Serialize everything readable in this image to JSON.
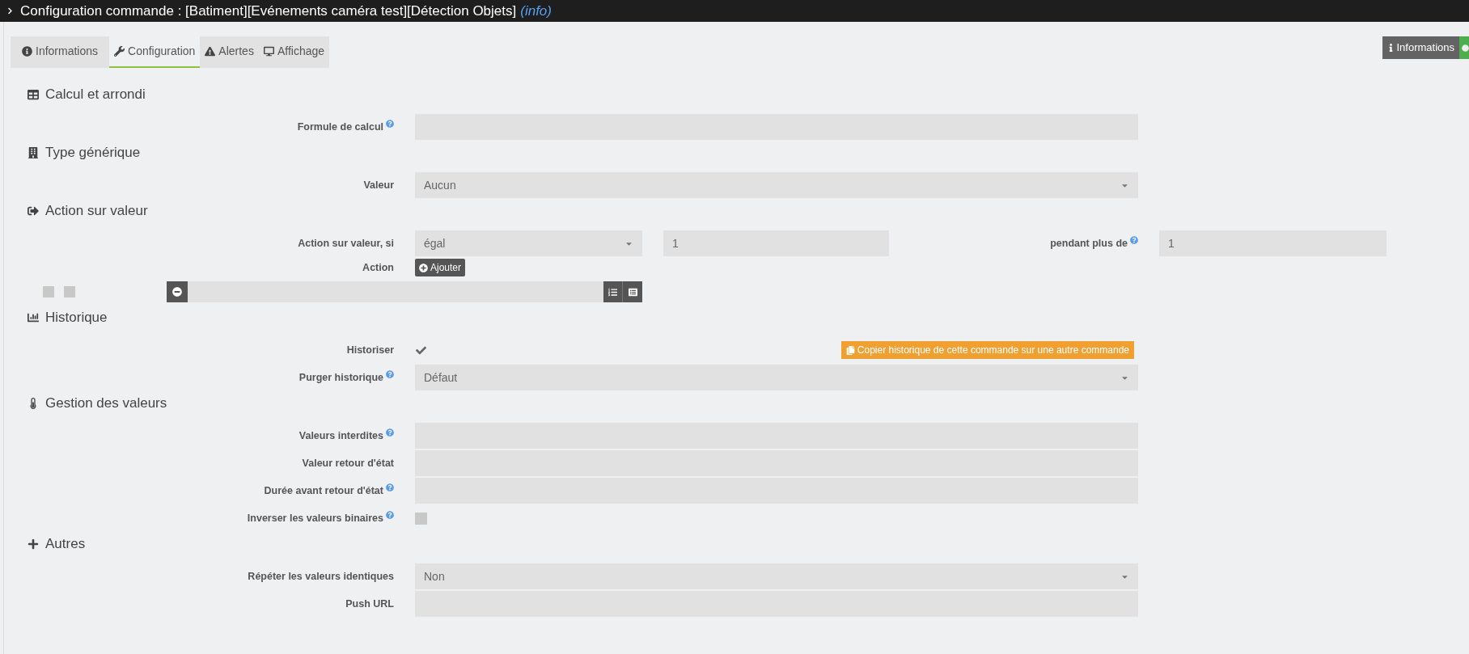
{
  "title_bar": {
    "title": "Configuration commande : [Batiment][Evénements caméra test][Détection Objets]",
    "info_link": "(info)"
  },
  "tabs": [
    {
      "label": "Informations",
      "selected": false
    },
    {
      "label": "Configuration",
      "selected": true
    },
    {
      "label": "Alertes",
      "selected": false
    },
    {
      "label": "Affichage",
      "selected": false
    }
  ],
  "side_buttons": [
    {
      "label": "Informations"
    }
  ],
  "sections": [
    {
      "title": "Calcul et arrondi",
      "rows": [
        {
          "kind": "input",
          "label": "Formule de calcul",
          "help": true
        }
      ]
    },
    {
      "title": "Type générique",
      "rows": [
        {
          "kind": "select",
          "label": "Valeur",
          "help": false,
          "value": "Aucun"
        }
      ]
    },
    {
      "title": "Action sur valeur",
      "rows": [
        {
          "kind": "condition",
          "label": "Action sur valeur, si",
          "operator": "égal",
          "value": "1",
          "duration_label": "pendant plus de",
          "duration_help": true,
          "duration": "1"
        },
        {
          "kind": "button",
          "label": "Action",
          "button": "Ajouter"
        },
        {
          "kind": "action_line",
          "checkboxes": [
            {
              "checked": false
            },
            {
              "checked": false
            }
          ]
        }
      ]
    },
    {
      "title": "Historique",
      "rows": [
        {
          "kind": "checkbox",
          "label": "Historiser",
          "help": false,
          "checked": true,
          "extra_button": "Copier historique de cette commande sur une autre commande"
        },
        {
          "kind": "select",
          "label": "Purger historique",
          "help": true,
          "value": "Défaut"
        }
      ]
    },
    {
      "title": "Gestion des valeurs",
      "rows": [
        {
          "kind": "input",
          "label": "Valeurs interdites",
          "help": true
        },
        {
          "kind": "input",
          "label": "Valeur retour d'état",
          "help": false
        },
        {
          "kind": "input",
          "label": "Durée avant retour d'état",
          "help": true
        },
        {
          "kind": "checkbox",
          "label": "Inverser les valeurs binaires",
          "help": true,
          "checked": false
        }
      ]
    },
    {
      "title": "Autres",
      "rows": [
        {
          "kind": "select",
          "label": "Répéter les valeurs identiques",
          "help": false,
          "value": "Non"
        },
        {
          "kind": "input",
          "label": "Push URL",
          "help": false
        }
      ]
    }
  ]
}
